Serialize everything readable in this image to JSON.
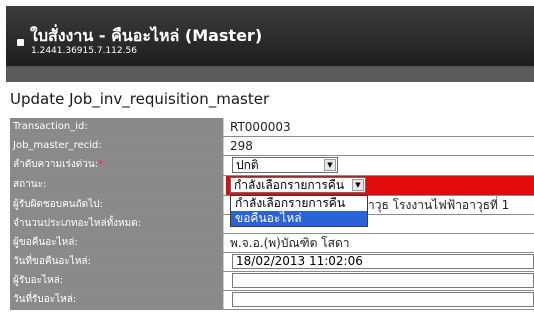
{
  "window": {
    "title": "ใบสั่งงาน - คืนอะไหล่ (Master)",
    "subtitle": "1.2441.36915.7.112.56"
  },
  "heading": "Update Job_inv_requisition_master",
  "fields": [
    {
      "label": "Transaction_id:",
      "value": "RT000003"
    },
    {
      "label": "Job_master_recid:",
      "value": "298"
    },
    {
      "label": "ลำดับความเร่งด่วน:",
      "required": "*",
      "value": "ปกติ"
    },
    {
      "label": "สถานะ:",
      "value": "กำลังเลือกรายการคืน"
    },
    {
      "label": "ผู้รับผิดชอบคนถัดไป:",
      "value": "าวุธ โรงงานไฟฟ้าอาวุธที่ 1"
    },
    {
      "label": "จำนวนประเภทอะไหล่ทั้งหมด:",
      "value": ""
    },
    {
      "label": "ผู้ขอคืนอะไหล่:",
      "value": "พ.จ.อ.(พ)บัณฑิต โสดา"
    },
    {
      "label": "วันที่ขอคืนอะไหล่:",
      "value": "18/02/2013 11:02:06"
    },
    {
      "label": "ผู้รับอะไหล่:",
      "value": ""
    },
    {
      "label": "วันที่รับอะไหล่:",
      "value": ""
    }
  ],
  "status_dropdown": {
    "options": [
      "กำลังเลือกรายการคืน",
      "ขอคืนอะไหล่"
    ],
    "highlighted_index": 1
  },
  "colors": {
    "status_row": "#e10b0b",
    "label_bg": "#8a8a8a",
    "highlight": "#2a62d8"
  },
  "icons": {
    "window": "window-icon",
    "select_arrow": "dropdown-arrow-icon"
  }
}
